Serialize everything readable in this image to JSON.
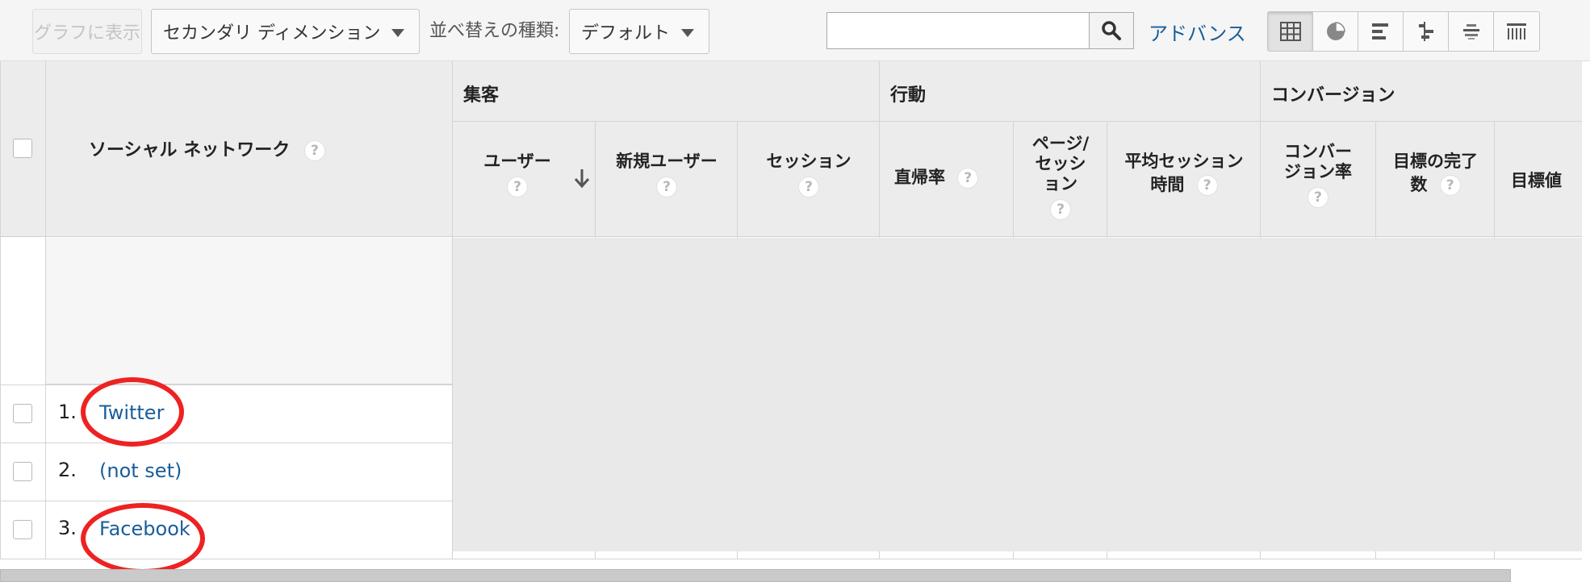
{
  "toolbar": {
    "graph_button_label": "グラフに表示",
    "secondary_dimension_label": "セカンダリ ディメンション",
    "sort_type_label": "並べ替えの種類:",
    "sort_value": "デフォルト",
    "search_value": "",
    "advanced_label": "アドバンス",
    "view_icons": [
      "table-view-icon",
      "pie-view-icon",
      "bar-view-icon",
      "comparison-view-icon",
      "term-cloud-view-icon",
      "pivot-view-icon"
    ]
  },
  "table": {
    "dimension_header": "ソーシャル ネットワーク",
    "groups": [
      {
        "label": "集客"
      },
      {
        "label": "行動"
      },
      {
        "label": "コンバージョン"
      }
    ],
    "columns": {
      "users": "ユーザー",
      "new_users": "新規ユーザー",
      "sessions": "セッション",
      "bounce_rate": "直帰率",
      "pages_per_session_1": "ページ/",
      "pages_per_session_2": "セッシ",
      "pages_per_session_3": "ョン",
      "avg_session_1": "平均セッション",
      "avg_session_2": "時間",
      "conversion_rate_1": "コンバー",
      "conversion_rate_2": "ジョン率",
      "goal_completions_1": "目標の完了",
      "goal_completions_2": "数",
      "goal_value": "目標値"
    },
    "help_glyph": "?",
    "rows": [
      {
        "num": "1.",
        "name": "Twitter"
      },
      {
        "num": "2.",
        "name": "(not set)"
      },
      {
        "num": "3.",
        "name": "Facebook"
      }
    ]
  },
  "colors": {
    "link": "#1a5e9a",
    "annotation": "#ee2222",
    "header_bg": "#ececec"
  }
}
